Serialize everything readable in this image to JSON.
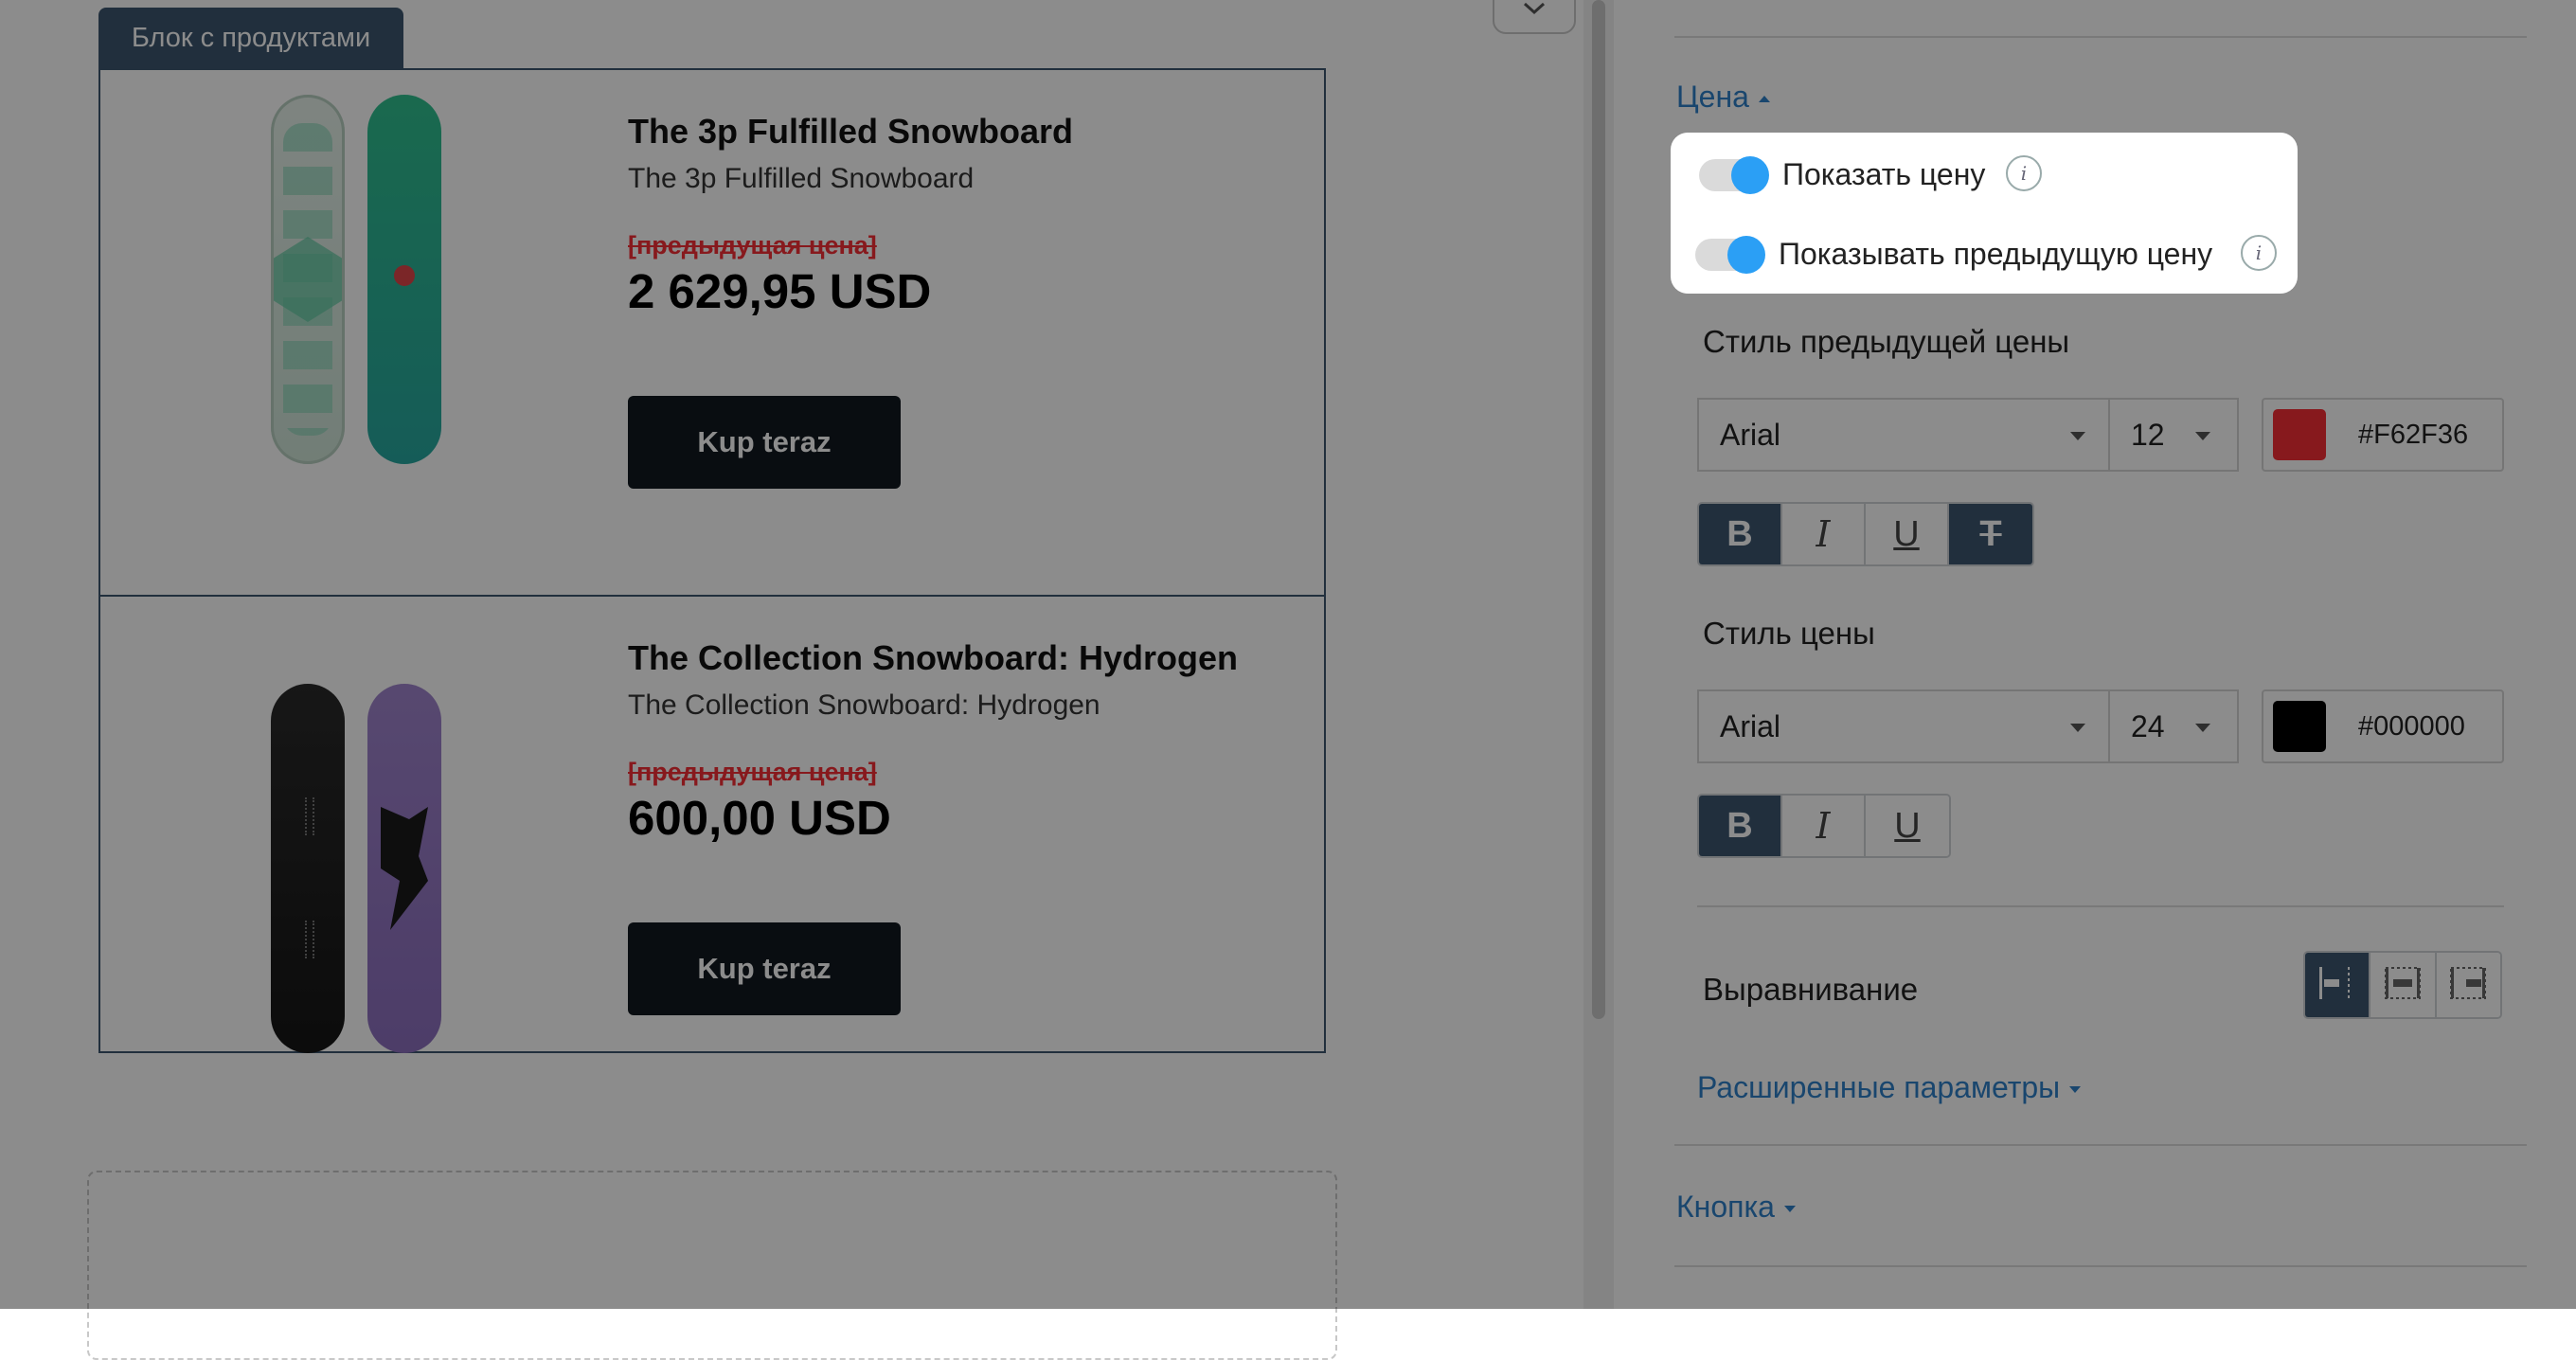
{
  "canvas": {
    "block_tab_label": "Блок с продуктами",
    "products": [
      {
        "title": "The 3p Fulfilled Snowboard",
        "subtitle": "The 3p Fulfilled Snowboard",
        "old_price": "[предыдущая цена]",
        "price": "2 629,95 USD",
        "button_label": "Kup teraz",
        "board_colors": [
          "#d9ebe0",
          "#2fb58a"
        ]
      },
      {
        "title": "The Collection Snowboard: Hydrogen",
        "subtitle": "The Collection Snowboard: Hydrogen",
        "old_price": "[предыдущая цена]",
        "price": "600,00 USD",
        "button_label": "Kup teraz",
        "board_colors": [
          "#1e1e1e",
          "#a07fd0"
        ]
      }
    ]
  },
  "settings": {
    "price_section": {
      "label": "Цена"
    },
    "show_price": {
      "label": "Показать цену",
      "enabled": true
    },
    "show_old_price": {
      "label": "Показывать предыдущую цену",
      "enabled": true
    },
    "old_price_style": {
      "label": "Стиль предыдущей цены",
      "font": "Arial",
      "size": "12",
      "color": "#F62F36",
      "bold": true,
      "italic": false,
      "underline": false,
      "strikethrough": true
    },
    "price_style": {
      "label": "Стиль цены",
      "font": "Arial",
      "size": "24",
      "color": "#000000",
      "bold": true,
      "italic": false,
      "underline": false
    },
    "alignment": {
      "label": "Выравнивание",
      "selected": "left"
    },
    "advanced_link": "Расширенные параметры",
    "button_section": {
      "label": "Кнопка"
    }
  },
  "colors": {
    "accent": "#2f80c8",
    "dark_button": "#111820",
    "active": "#3d5770",
    "toggle_on": "#2b9ff5"
  }
}
